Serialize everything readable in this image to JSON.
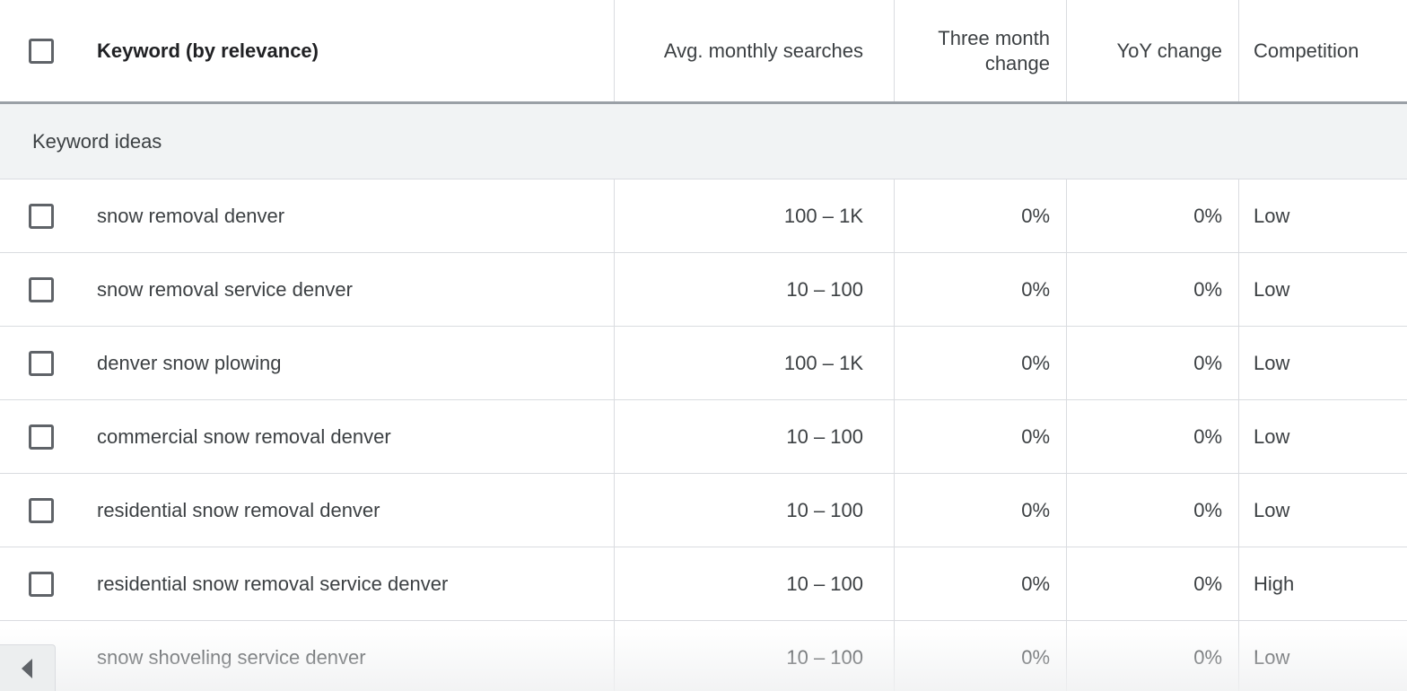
{
  "header": {
    "select_all": "",
    "keyword": "Keyword (by relevance)",
    "avg_monthly": "Avg. monthly searches",
    "three_month_line1": "Three month",
    "three_month_line2": "change",
    "yoy": "YoY change",
    "competition": "Competition"
  },
  "group": {
    "label": "Keyword ideas"
  },
  "rows": [
    {
      "keyword": "snow removal denver",
      "avg": "100 – 1K",
      "three_month": "0%",
      "yoy": "0%",
      "competition": "Low"
    },
    {
      "keyword": "snow removal service denver",
      "avg": "10 – 100",
      "three_month": "0%",
      "yoy": "0%",
      "competition": "Low"
    },
    {
      "keyword": "denver snow plowing",
      "avg": "100 – 1K",
      "three_month": "0%",
      "yoy": "0%",
      "competition": "Low"
    },
    {
      "keyword": "commercial snow removal denver",
      "avg": "10 – 100",
      "three_month": "0%",
      "yoy": "0%",
      "competition": "Low"
    },
    {
      "keyword": "residential snow removal denver",
      "avg": "10 – 100",
      "three_month": "0%",
      "yoy": "0%",
      "competition": "Low"
    },
    {
      "keyword": "residential snow removal service denver",
      "avg": "10 – 100",
      "three_month": "0%",
      "yoy": "0%",
      "competition": "High"
    },
    {
      "keyword": "snow shoveling service denver",
      "avg": "10 – 100",
      "three_month": "0%",
      "yoy": "0%",
      "competition": "Low"
    }
  ],
  "icons": {
    "scroll_left": "chevron-left-icon",
    "checkbox": "checkbox-icon"
  },
  "colors": {
    "text": "#3c4043",
    "header_text": "#202124",
    "border": "#dadce0",
    "group_bg": "#f1f3f4",
    "checkbox_border": "#5f6368"
  }
}
